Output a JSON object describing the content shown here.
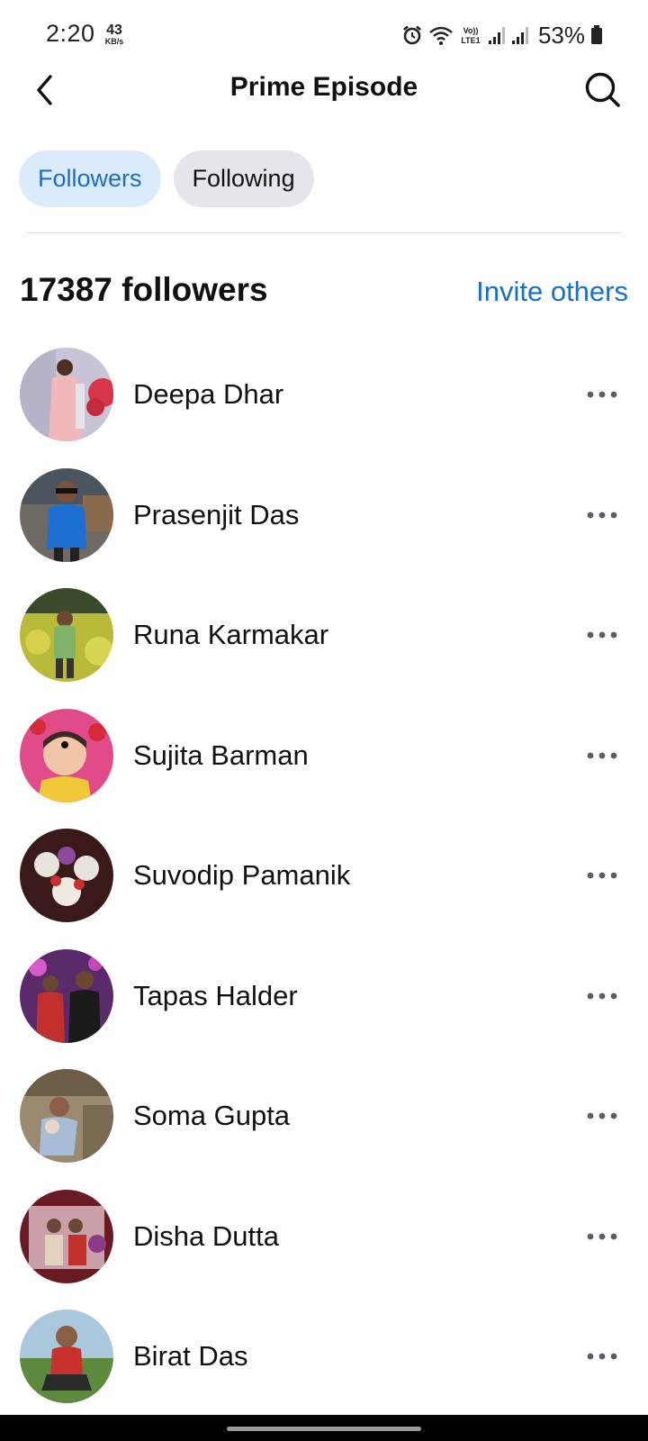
{
  "status_bar": {
    "time": "2:20",
    "speed_value": "43",
    "speed_unit": "KB/s",
    "battery": "53%"
  },
  "header": {
    "title": "Prime Episode"
  },
  "tabs": [
    {
      "label": "Followers",
      "active": true
    },
    {
      "label": "Following",
      "active": false
    }
  ],
  "followers": {
    "count_label": "17387 followers",
    "invite_label": "Invite others",
    "accent_color": "#1a6fc4",
    "items": [
      {
        "name": "Deepa Dhar"
      },
      {
        "name": "Prasenjit Das"
      },
      {
        "name": "Runa Karmakar"
      },
      {
        "name": "Sujita Barman"
      },
      {
        "name": "Suvodip Pamanik"
      },
      {
        "name": "Tapas Halder"
      },
      {
        "name": "Soma Gupta"
      },
      {
        "name": "Disha Dutta"
      },
      {
        "name": "Birat Das"
      }
    ]
  }
}
